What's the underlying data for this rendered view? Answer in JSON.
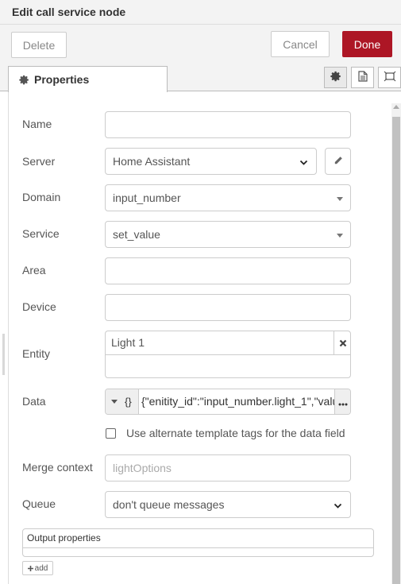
{
  "dialog": {
    "title": "Edit call service node",
    "delete_label": "Delete",
    "cancel_label": "Cancel",
    "done_label": "Done",
    "accent_color": "#ad1625"
  },
  "tabs": {
    "properties_label": "Properties",
    "icon_tabs": [
      "gear-icon",
      "description-icon",
      "appearance-icon"
    ]
  },
  "form": {
    "name": {
      "label": "Name",
      "value": ""
    },
    "server": {
      "label": "Server",
      "value": "Home Assistant"
    },
    "domain": {
      "label": "Domain",
      "value": "input_number"
    },
    "service": {
      "label": "Service",
      "value": "set_value"
    },
    "area": {
      "label": "Area",
      "value": ""
    },
    "device": {
      "label": "Device",
      "value": ""
    },
    "entity": {
      "label": "Entity",
      "tag": "Light 1"
    },
    "data": {
      "label": "Data",
      "type_symbol": "{}",
      "value": "{\"enitity_id\":\"input_number.light_1\",\"valu"
    },
    "alt_template": {
      "label": "Use alternate template tags for the data field",
      "checked": false
    },
    "merge_context": {
      "label": "Merge context",
      "placeholder": "lightOptions"
    },
    "queue": {
      "label": "Queue",
      "value": "don't queue messages"
    }
  },
  "output": {
    "header": "Output properties",
    "add_label": "add"
  }
}
